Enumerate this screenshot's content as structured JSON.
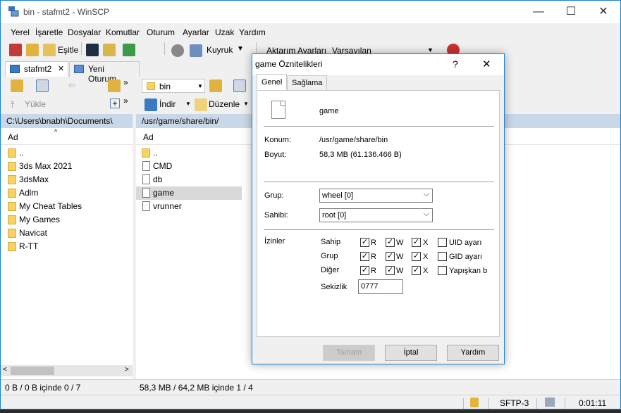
{
  "window": {
    "title": "bin - stafmt2 - WinSCP",
    "controls": [
      "—",
      "☐",
      "✕"
    ]
  },
  "menu": [
    "Yerel",
    "İşaretle",
    "Dosyalar",
    "Komutlar",
    "Oturum",
    "Ayarlar",
    "Uzak",
    "Yardım"
  ],
  "toolbar": {
    "sync_label": "Eşitle",
    "queue_label": "Kuyruk",
    "transfer_settings_label": "Aktarım Ayarları",
    "transfer_settings_value": "Varsayılan"
  },
  "tabs": {
    "session": "stafmt2",
    "new_session": "Yeni Oturum"
  },
  "local": {
    "upload_label": "Yükle",
    "path": "C:\\Users\\bnabh\\Documents\\",
    "column": "Ad",
    "items": [
      "..",
      "3ds Max 2021",
      "3dsMax",
      "Adlm",
      "My Cheat Tables",
      "My Games",
      "Navicat",
      "R-TT"
    ],
    "status": "0 B / 0 B içinde 0 / 7"
  },
  "remote": {
    "dir_combo": "bin",
    "download_label": "İndir",
    "edit_label": "Düzenle",
    "path": "/usr/game/share/bin/",
    "column": "Ad",
    "items": [
      "..",
      "CMD",
      "db",
      "game",
      "vrunner"
    ],
    "status": "58,3 MB / 64,2 MB içinde 1 / 4"
  },
  "bottom": {
    "protocol": "SFTP-3",
    "time": "0:01:11"
  },
  "dialog": {
    "title": "game Öznitelikleri",
    "help_glyph": "?",
    "close_glyph": "✕",
    "tabs": [
      "Genel",
      "Sağlama"
    ],
    "filename": "game",
    "location_label": "Konum:",
    "location_value": "/usr/game/share/bin",
    "size_label": "Boyut:",
    "size_value": "58,3 MB (61.136.466 B)",
    "group_label": "Grup:",
    "group_value": "wheel [0]",
    "owner_label": "Sahibi:",
    "owner_value": "root [0]",
    "permissions_label": "İzinler",
    "perm_rows": [
      {
        "label": "Sahip",
        "r": "R",
        "w": "W",
        "x": "X",
        "extra": "UID ayarı"
      },
      {
        "label": "Grup",
        "r": "R",
        "w": "W",
        "x": "X",
        "extra": "GID ayarı"
      },
      {
        "label": "Diğer",
        "r": "R",
        "w": "W",
        "x": "X",
        "extra": "Yapışkan bit"
      }
    ],
    "octal_label": "Sekizlik",
    "octal_value": "0777",
    "buttons": {
      "ok": "Tamam",
      "cancel": "İptal",
      "help": "Yardım"
    }
  }
}
